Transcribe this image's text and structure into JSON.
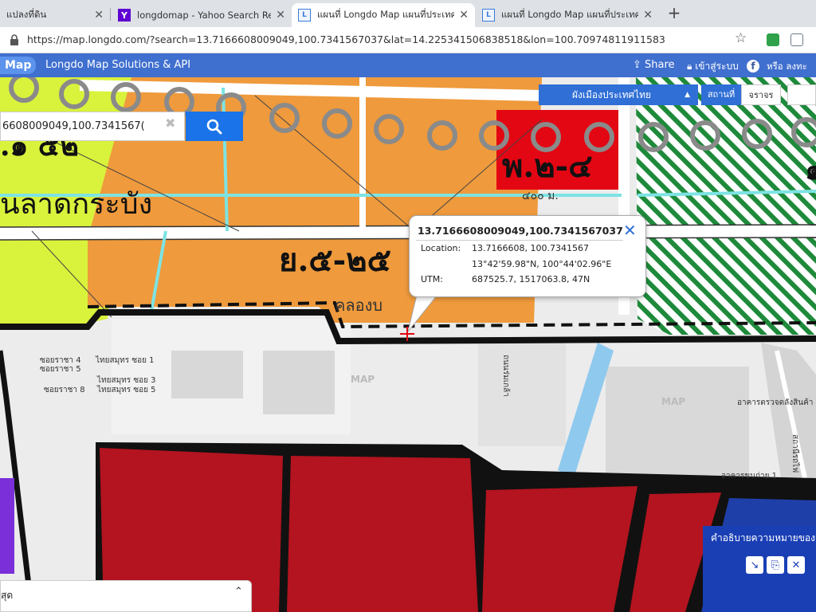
{
  "browser": {
    "tabs": [
      {
        "title": "แปลงที่ดิน",
        "icon": "",
        "active": false
      },
      {
        "title": "longdomap - Yahoo Search Results",
        "icon": "Y",
        "active": false
      },
      {
        "title": "แผนที่ Longdo Map แผนที่ประเทศไทย",
        "icon": "L",
        "active": true
      },
      {
        "title": "แผนที่ Longdo Map แผนที่ประเทศไทย",
        "icon": "L",
        "active": false
      }
    ],
    "new_tab": "+",
    "close_glyph": "✕",
    "url": "https://map.longdo.com/?search=13.7166608009049,100.7341567037&lat=14.225341506838518&lon=100.70974811911583"
  },
  "header": {
    "logo": "Map",
    "title": "Longdo Map Solutions & API",
    "share": "Share",
    "login": "เข้าสู่ระบบ",
    "or_text": "หรือ ลงทะ"
  },
  "controls": {
    "layer_dropdown": "ผังเมืองประเทศไทย",
    "place_button": "สถานที่",
    "traffic_button": "จราจร"
  },
  "search": {
    "value": "6608009049,100.7341567(",
    "button_icon": "search-icon"
  },
  "map": {
    "labels": {
      "zone_top": "พ.๒-๔",
      "zone_mid": "ย.๕-๒๕",
      "road_name": "นลาดกระบัง",
      "zone_topleft": ".๑ ๕๒",
      "canal": "คลองบ",
      "zone_dist": "๔๐๐ ม.",
      "right_char": "๑",
      "soi_4": "ซอยราชา 4",
      "soi_5": "ซอยราชา 5",
      "soi_8": "ซอยราชา 8",
      "tss_1": "ไทยสมุทร ซอย 1",
      "tss_3": "ไทยสมุทร ซอย 3",
      "tss_5": "ไทยสมุทร ซอย 5",
      "road_right": "ถนนร่มเกล้า",
      "building": "อาคารตรวจตลังสินค้า",
      "rail": "สถานีรถไฟ",
      "cargo": "อาคารขนถ่าย 1",
      "watermark": "MAP"
    }
  },
  "popup": {
    "title": "13.7166608009049,100.7341567037",
    "location_label": "Location:",
    "location_dec": "13.7166608, 100.7341567",
    "location_dms": "13°42'59.98\"N, 100°44'02.96\"E",
    "utm_label": "UTM:",
    "utm_value": "687525.7, 1517063.8, 47N",
    "close": "✕"
  },
  "legend": {
    "title": "คำอธิบายความหมายของสี"
  },
  "drawer": {
    "label": "สุด",
    "chevron": "⌃"
  },
  "colors": {
    "orange_zone": "#ef9a3c",
    "red_zone": "#e30613",
    "dark_red_zone": "#b3141f",
    "yellow_zone": "#d9f23c",
    "green_hatch": "#1e8a3b",
    "header_blue": "#3f6fcf"
  }
}
